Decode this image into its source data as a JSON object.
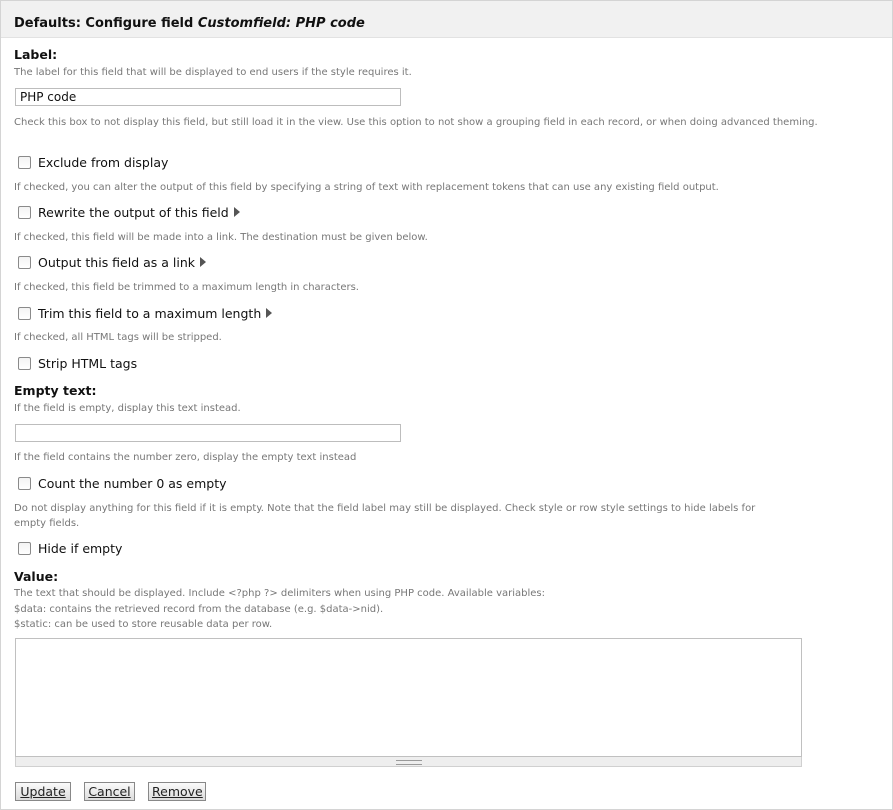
{
  "header": {
    "prefix": "Defaults: Configure field ",
    "field_name": "Customfield: PHP code"
  },
  "label_section": {
    "title": "Label:",
    "description": "The label for this field that will be displayed to end users if the style requires it.",
    "value": "PHP code"
  },
  "exclude": {
    "description": "Check this box to not display this field, but still load it in the view. Use this option to not show a grouping field in each record, or when doing advanced theming.",
    "label": "Exclude from display",
    "checked": false
  },
  "rewrite": {
    "description": "If checked, you can alter the output of this field by specifying a string of text with replacement tokens that can use any existing field output.",
    "label": "Rewrite the output of this field",
    "checked": false
  },
  "link": {
    "description": "If checked, this field will be made into a link. The destination must be given below.",
    "label": "Output this field as a link",
    "checked": false
  },
  "trim": {
    "description": "If checked, this field be trimmed to a maximum length in characters.",
    "label": "Trim this field to a maximum length",
    "checked": false
  },
  "strip": {
    "description": "If checked, all HTML tags will be stripped.",
    "label": "Strip HTML tags",
    "checked": false
  },
  "empty_text": {
    "title": "Empty text:",
    "description": "If the field is empty, display this text instead.",
    "value": ""
  },
  "count_zero": {
    "description": "If the field contains the number zero, display the empty text instead",
    "label": "Count the number 0 as empty",
    "checked": false
  },
  "hide_empty": {
    "description_line1": "Do not display anything for this field if it is empty. Note that the field label may still be displayed. Check style or row style settings to hide labels for",
    "description_line2": "empty fields.",
    "label": "Hide if empty",
    "checked": false
  },
  "value_section": {
    "title": "Value:",
    "description_line1": "The text that should be displayed. Include <?php ?> delimiters when using PHP code. Available variables:",
    "description_line2": "$data: contains the retrieved record from the database (e.g. $data->nid).",
    "description_line3": "$static: can be used to store reusable data per row.",
    "value": ""
  },
  "buttons": {
    "update": "Update",
    "cancel": "Cancel",
    "remove": "Remove"
  },
  "icons": {
    "expand": "triangle-right-icon",
    "resize": "resize-grip-icon"
  }
}
